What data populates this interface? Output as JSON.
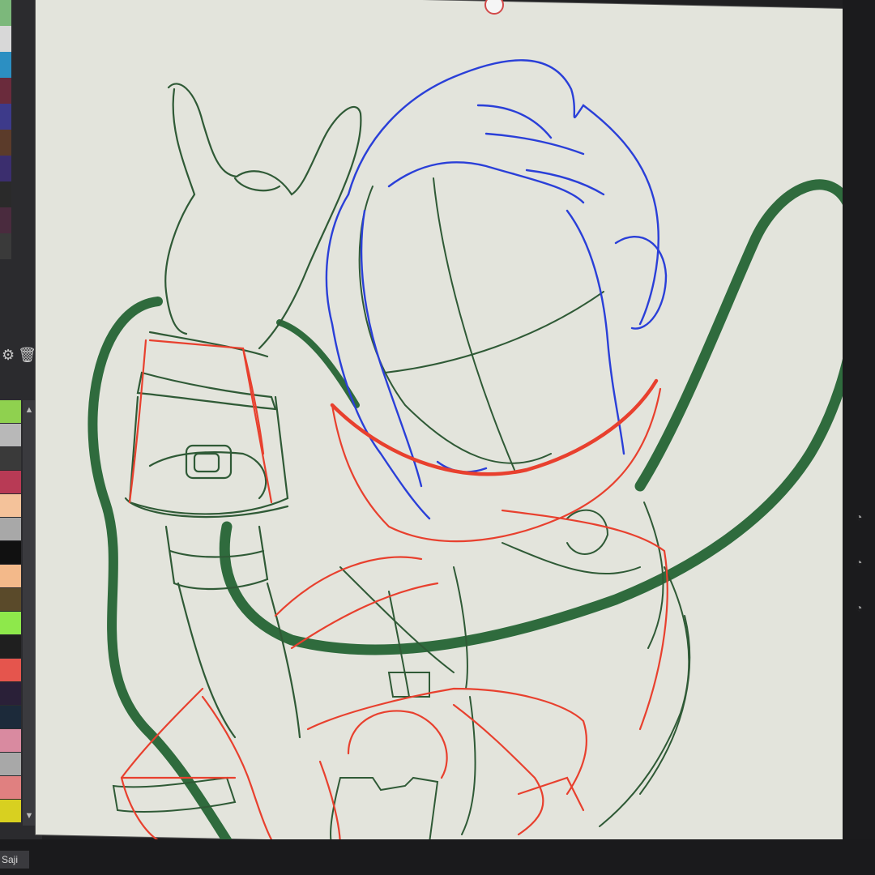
{
  "palette": {
    "strip_colors": [
      "#7cb87b",
      "#d8d8d8",
      "#2c8fc2",
      "#6a2b3c",
      "#3d3a8a",
      "#5b3b2a",
      "#3b2e6e",
      "#2a2a2a",
      "#4a2b3e",
      "#3a3a3a"
    ],
    "swatches": [
      "#8fd14f",
      "#b8b8b8",
      "#3a3a3a",
      "#b83a55",
      "#f4c29a",
      "#a8a8a8",
      "#111111",
      "#f3b98a",
      "#5a4a2a",
      "#8ee84b",
      "#1f1f1f",
      "#e5554d",
      "#2a2038",
      "#1c2a3a",
      "#d98aa0",
      "#a8a8a8",
      "#e08080",
      "#d8d020"
    ],
    "trash_icon": "trash-icon",
    "adjust_icon": "adjust-icon",
    "scroll_up_icon": "chevron-up-icon",
    "scroll_down_icon": "chevron-down-icon"
  },
  "layer": {
    "label": "Saji"
  },
  "canvas": {
    "background": "#e3e4dc",
    "stroke_colors": {
      "sketch_green": "#2f5a36",
      "thick_green": "#2f6b3d",
      "blue": "#2a3fd8",
      "red": "#e8402e"
    }
  },
  "right_panel": {
    "icons": [
      "eye-icon",
      "eye-icon",
      "eye-icon"
    ]
  }
}
